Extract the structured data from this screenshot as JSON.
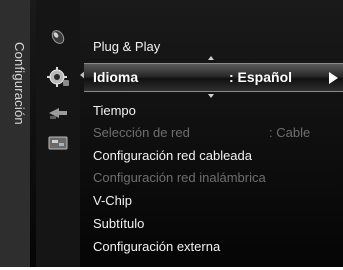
{
  "sidebar": {
    "category_label": "Configuración",
    "icons": [
      "picture-icon",
      "settings-icon",
      "input-icon",
      "application-icon"
    ]
  },
  "menu": {
    "items": [
      {
        "label": "Plug & Play",
        "enabled": true
      },
      {
        "label": "Idioma",
        "value": ": Español",
        "selected": true
      },
      {
        "label": "Tiempo",
        "enabled": true
      },
      {
        "label": "Selección de red",
        "value": ": Cable",
        "enabled": false
      },
      {
        "label": "Configuración red cableada",
        "enabled": true
      },
      {
        "label": "Configuración red inalámbrica",
        "enabled": false
      },
      {
        "label": "V-Chip",
        "enabled": true
      },
      {
        "label": "Subtítulo",
        "enabled": true
      },
      {
        "label": "Configuración externa",
        "enabled": true
      }
    ]
  },
  "colors": {
    "background": "#0b0b0b",
    "text": "#f2f2f2",
    "disabled_text": "#6e6e6e",
    "highlight": "#2a2a2a"
  }
}
